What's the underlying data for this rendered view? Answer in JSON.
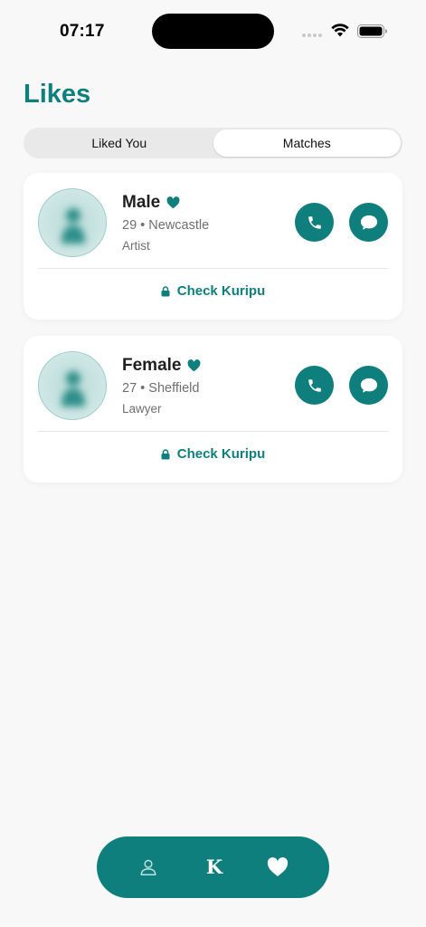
{
  "status_bar": {
    "time": "07:17"
  },
  "page": {
    "title": "Likes"
  },
  "tabs": [
    {
      "label": "Liked You",
      "active": false
    },
    {
      "label": "Matches",
      "active": true
    }
  ],
  "matches": [
    {
      "name": "Male",
      "age": "29",
      "separator": "•",
      "city": "Newcastle",
      "occupation": "Artist",
      "check_label": "Check Kuripu"
    },
    {
      "name": "Female",
      "age": "27",
      "separator": "•",
      "city": "Sheffield",
      "occupation": "Lawyer",
      "check_label": "Check Kuripu"
    }
  ],
  "bottom_nav": {
    "items": [
      {
        "icon": "profile-icon"
      },
      {
        "icon": "k-logo-icon",
        "label": "K"
      },
      {
        "icon": "heart-icon",
        "active": true
      }
    ]
  },
  "colors": {
    "accent": "#0e7f7c",
    "background": "#f8f8f8",
    "card": "#ffffff",
    "muted_text": "#6f6f6f"
  }
}
